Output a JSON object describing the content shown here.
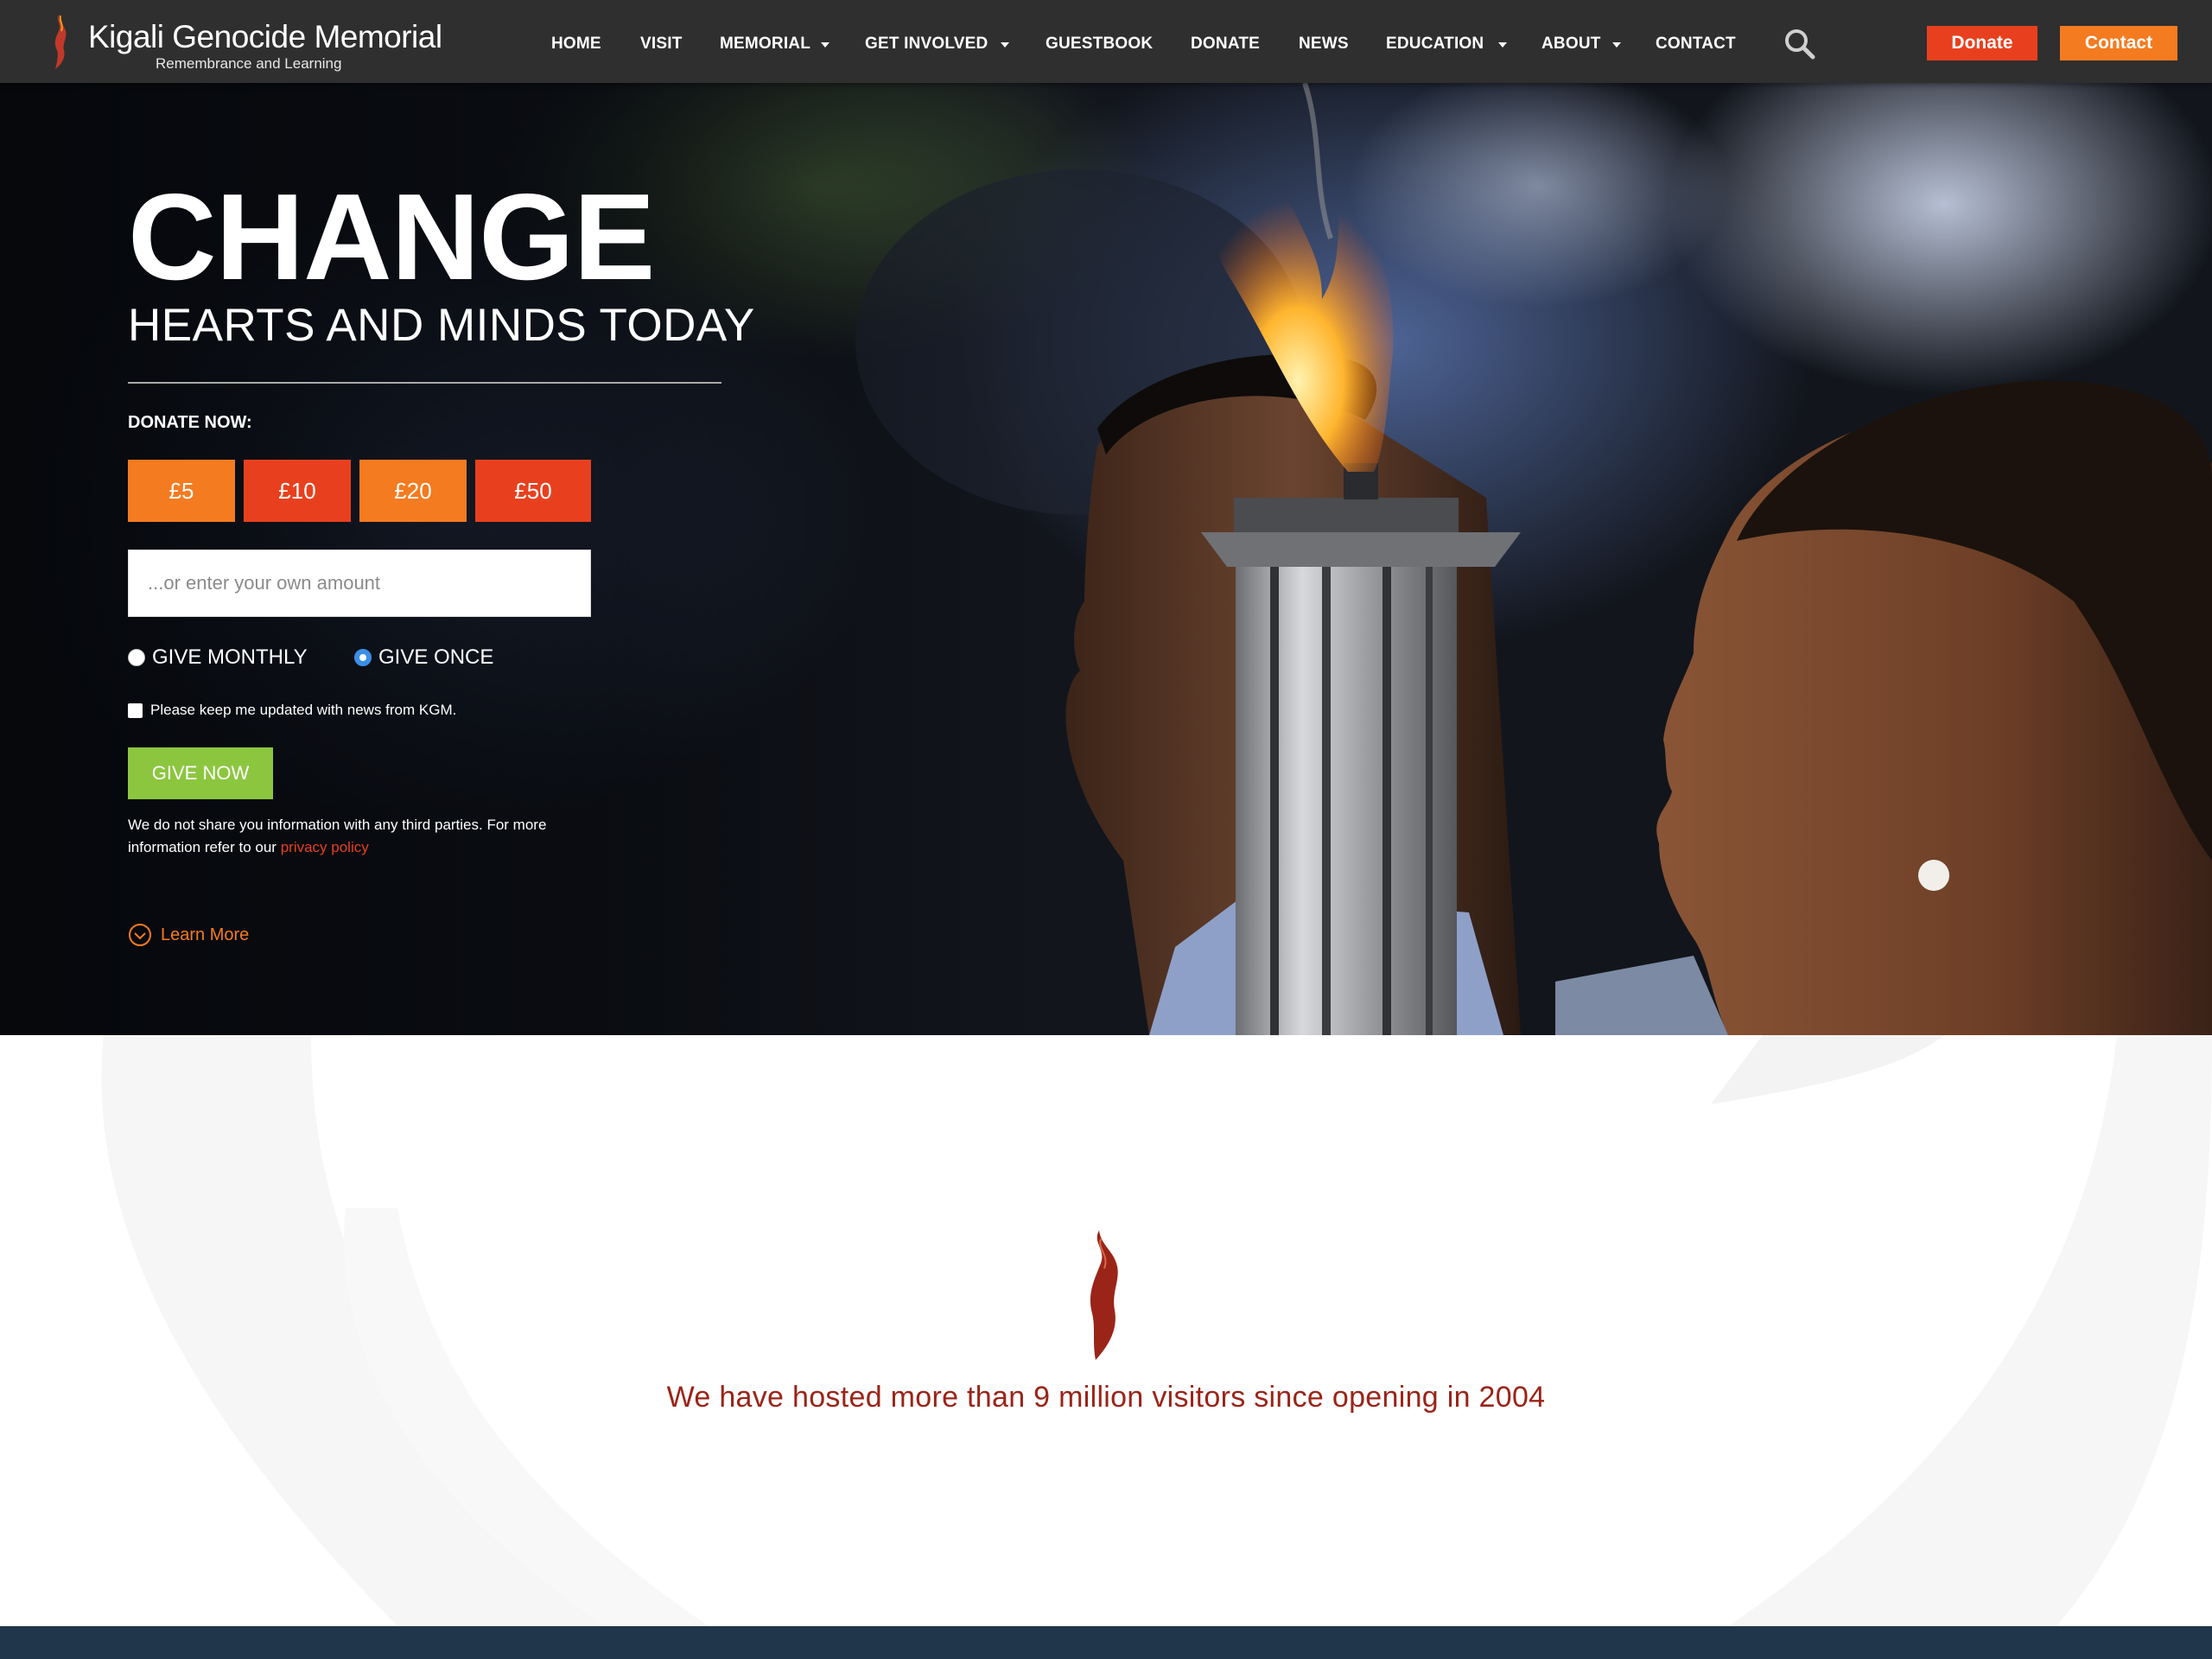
{
  "brand": {
    "title": "Kigali Genocide Memorial",
    "subtitle": "Remembrance and Learning"
  },
  "nav": {
    "items": [
      {
        "label": "HOME",
        "dropdown": false
      },
      {
        "label": "VISIT",
        "dropdown": false
      },
      {
        "label": "MEMORIAL",
        "dropdown": true
      },
      {
        "label": "GET INVOLVED",
        "dropdown": true
      },
      {
        "label": "GUESTBOOK",
        "dropdown": false
      },
      {
        "label": "DONATE",
        "dropdown": false
      },
      {
        "label": "NEWS",
        "dropdown": false
      },
      {
        "label": "EDUCATION",
        "dropdown": true
      },
      {
        "label": "ABOUT",
        "dropdown": true
      },
      {
        "label": "CONTACT",
        "dropdown": false
      }
    ],
    "search_icon": "search-icon",
    "donate_label": "Donate",
    "contact_label": "Contact"
  },
  "hero": {
    "title": "CHANGE",
    "subtitle": "HEARTS AND MINDS TODAY",
    "donate_label": "DONATE NOW:",
    "amounts": [
      "£5",
      "£10",
      "£20",
      "£50"
    ],
    "amount_placeholder": "...or enter your own amount",
    "frequency": [
      {
        "label": "GIVE MONTHLY",
        "checked": false
      },
      {
        "label": "GIVE ONCE",
        "checked": true
      }
    ],
    "updates_label": "Please keep me updated with news from KGM.",
    "updates_checked": false,
    "give_label": "GIVE NOW",
    "privacy_text": "We do not share you information with any third parties. For more information refer to our",
    "privacy_link": "privacy policy",
    "learn_more": "Learn More"
  },
  "stats": {
    "text": "We have hosted more than 9 million visitors since opening in 2004"
  },
  "colors": {
    "nav_bg": "#2f2f2f",
    "orange": "#f47b20",
    "red_orange": "#e8401e",
    "green": "#8cc63f",
    "maroon": "#9a2418",
    "footer": "#20364a"
  }
}
